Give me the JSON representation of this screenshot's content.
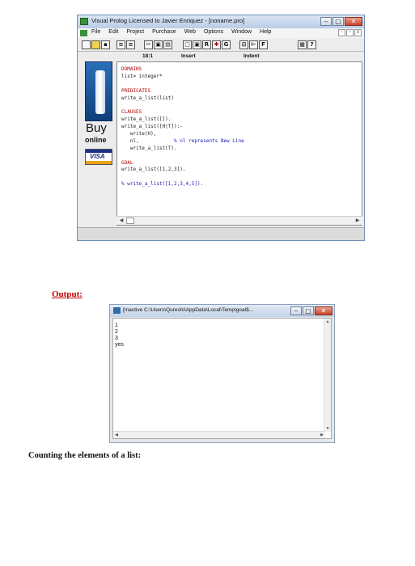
{
  "vp_window": {
    "title": "Visual Prolog Licensed to Javier Enriquez - [noname.pro]",
    "menu": [
      "File",
      "Edit",
      "Project",
      "Purchase",
      "Web",
      "Options",
      "Window",
      "Help"
    ],
    "toolbar_letters": [
      "R",
      "G",
      "F"
    ],
    "status": {
      "position": "18:1",
      "mode": "Insert",
      "indent": "Indent"
    },
    "code": [
      {
        "text": "DOMAINS",
        "kind": "sec"
      },
      {
        "text": "list= integer*",
        "kind": "code"
      },
      {
        "text": "",
        "kind": "code"
      },
      {
        "text": "PREDICATES",
        "kind": "sec"
      },
      {
        "text": "write_a_list(list)",
        "kind": "code"
      },
      {
        "text": "",
        "kind": "code"
      },
      {
        "text": "CLAUSES",
        "kind": "sec"
      },
      {
        "text": "write_a_list([]).",
        "kind": "code"
      },
      {
        "text": "write_a_list([H|T]):-",
        "kind": "code"
      },
      {
        "text": "   write(H),",
        "kind": "code"
      },
      {
        "text": "   nl,            % nl represents New Line",
        "kind": "mixed",
        "code_part": "   nl,            ",
        "comment_part": "% nl represents New Line"
      },
      {
        "text": "   write_a_list(T).",
        "kind": "code"
      },
      {
        "text": "",
        "kind": "code"
      },
      {
        "text": "GOAL",
        "kind": "sec"
      },
      {
        "text": "write_a_list([1,2,3]).",
        "kind": "code"
      },
      {
        "text": "",
        "kind": "code"
      },
      {
        "text": "% write_a_list([1,2,3,4,5]).",
        "kind": "cmt"
      }
    ],
    "ad": {
      "buy": "Buy",
      "online": "online",
      "card": "VISA"
    }
  },
  "output_label": "Output:",
  "console": {
    "title": "[Inactive C:\\Users\\Qureshi\\AppData\\Local\\Temp\\goal$...",
    "lines": [
      "1",
      "2",
      "3",
      "yes"
    ]
  },
  "heading": "Counting the elements of a list:",
  "colors": {
    "section": "#b00000",
    "comment": "#1a1ab8",
    "output_label": "#c00000"
  }
}
